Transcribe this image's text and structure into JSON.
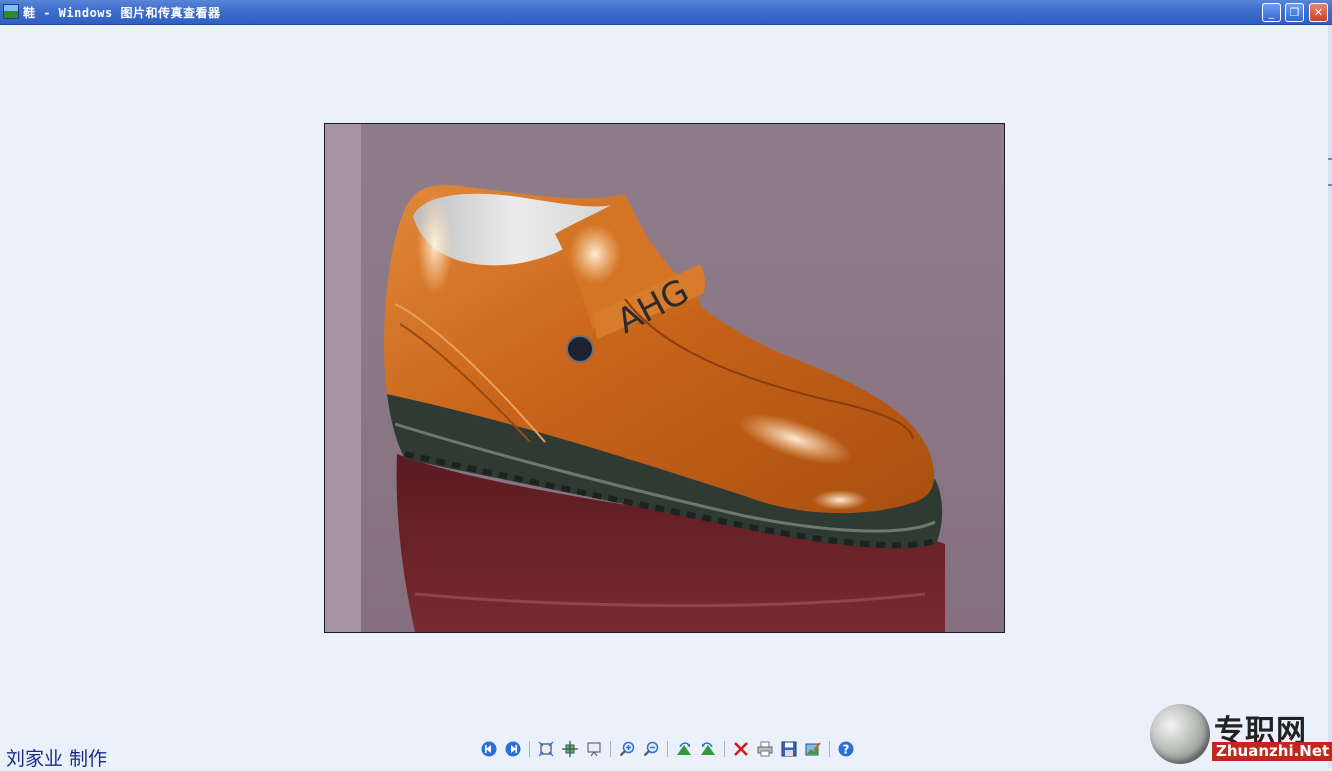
{
  "window": {
    "title": "鞋 - Windows 图片和传真查看器",
    "controls": {
      "minimize": "_",
      "maximize": "❐",
      "close": "✕"
    }
  },
  "toolbar": {
    "buttons": [
      {
        "name": "previous-image",
        "icon": "previous-icon"
      },
      {
        "name": "next-image",
        "icon": "next-icon"
      },
      {
        "name": "best-fit",
        "icon": "best-fit-icon"
      },
      {
        "name": "actual-size",
        "icon": "actual-size-icon"
      },
      {
        "name": "slide-show",
        "icon": "slideshow-icon"
      },
      {
        "name": "zoom-in",
        "icon": "zoom-in-icon"
      },
      {
        "name": "zoom-out",
        "icon": "zoom-out-icon"
      },
      {
        "name": "rotate-clockwise",
        "icon": "rotate-cw-icon"
      },
      {
        "name": "rotate-counterclockwise",
        "icon": "rotate-ccw-icon"
      },
      {
        "name": "delete",
        "icon": "delete-icon"
      },
      {
        "name": "print",
        "icon": "print-icon"
      },
      {
        "name": "copy-to",
        "icon": "save-icon"
      },
      {
        "name": "open-for-editing",
        "icon": "edit-icon"
      },
      {
        "name": "help",
        "icon": "help-icon"
      }
    ]
  },
  "photo": {
    "strap_text": "AHG"
  },
  "credit": "刘家业 制作",
  "watermark": {
    "chinese": "专职网",
    "english": "Zhuanzhi.Net"
  },
  "colors": {
    "title_bar": "#3f6fcf",
    "background": "#eaf1fa",
    "shoe": "#c8661a",
    "credit": "#1b2d8a",
    "watermark_red": "#c0281e"
  }
}
